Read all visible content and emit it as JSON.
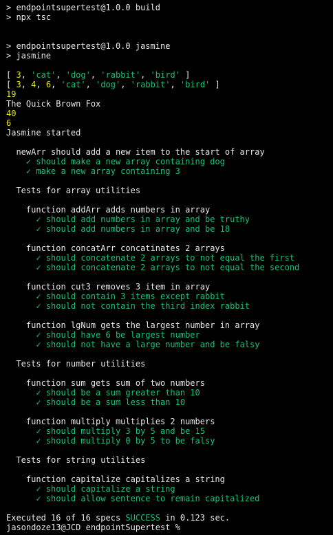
{
  "colors": {
    "background": "#000000",
    "foreground": "#e8e8e8",
    "number": "#e5e510",
    "success": "#1fbf7a"
  },
  "lines": [
    [
      {
        "t": "> endpointsupertest@1.0.0 build",
        "c": "w"
      }
    ],
    [
      {
        "t": "> npx tsc",
        "c": "w"
      }
    ],
    [],
    [],
    [
      {
        "t": "> endpointsupertest@1.0.0 jasmine",
        "c": "w"
      }
    ],
    [
      {
        "t": "> jasmine",
        "c": "w"
      }
    ],
    [],
    [
      {
        "t": "[ ",
        "c": "w"
      },
      {
        "t": "3",
        "c": "y"
      },
      {
        "t": ", ",
        "c": "w"
      },
      {
        "t": "'cat'",
        "c": "g"
      },
      {
        "t": ", ",
        "c": "w"
      },
      {
        "t": "'dog'",
        "c": "g"
      },
      {
        "t": ", ",
        "c": "w"
      },
      {
        "t": "'rabbit'",
        "c": "g"
      },
      {
        "t": ", ",
        "c": "w"
      },
      {
        "t": "'bird'",
        "c": "g"
      },
      {
        "t": " ]",
        "c": "w"
      }
    ],
    [
      {
        "t": "[ ",
        "c": "w"
      },
      {
        "t": "3",
        "c": "y"
      },
      {
        "t": ", ",
        "c": "w"
      },
      {
        "t": "4",
        "c": "y"
      },
      {
        "t": ", ",
        "c": "w"
      },
      {
        "t": "6",
        "c": "y"
      },
      {
        "t": ", ",
        "c": "w"
      },
      {
        "t": "'cat'",
        "c": "g"
      },
      {
        "t": ", ",
        "c": "w"
      },
      {
        "t": "'dog'",
        "c": "g"
      },
      {
        "t": ", ",
        "c": "w"
      },
      {
        "t": "'rabbit'",
        "c": "g"
      },
      {
        "t": ", ",
        "c": "w"
      },
      {
        "t": "'bird'",
        "c": "g"
      },
      {
        "t": " ]",
        "c": "w"
      }
    ],
    [
      {
        "t": "19",
        "c": "y"
      }
    ],
    [
      {
        "t": "The Quick Brown Fox",
        "c": "w"
      }
    ],
    [
      {
        "t": "40",
        "c": "y"
      }
    ],
    [
      {
        "t": "6",
        "c": "y"
      }
    ],
    [
      {
        "t": "Jasmine started",
        "c": "w"
      }
    ],
    [],
    [
      {
        "t": "  newArr should add a new item to the start of array",
        "c": "w"
      }
    ],
    [
      {
        "t": "    ✓ should make a new array containing dog",
        "c": "g"
      }
    ],
    [
      {
        "t": "    ✓ make a new array containing 3",
        "c": "g"
      }
    ],
    [],
    [
      {
        "t": "  Tests for array utilities",
        "c": "w"
      }
    ],
    [],
    [
      {
        "t": "    function addArr adds numbers in array",
        "c": "w"
      }
    ],
    [
      {
        "t": "      ✓ should add numbers in array and be truthy",
        "c": "g"
      }
    ],
    [
      {
        "t": "      ✓ should add numbers in array and be 18",
        "c": "g"
      }
    ],
    [],
    [
      {
        "t": "    function concatArr concatinates 2 arrays",
        "c": "w"
      }
    ],
    [
      {
        "t": "      ✓ should concatenate 2 arrays to not equal the first",
        "c": "g"
      }
    ],
    [
      {
        "t": "      ✓ should concatenate 2 arrays to not equal the second",
        "c": "g"
      }
    ],
    [],
    [
      {
        "t": "    function cut3 removes 3 item in array",
        "c": "w"
      }
    ],
    [
      {
        "t": "      ✓ should contain 3 items except rabbit",
        "c": "g"
      }
    ],
    [
      {
        "t": "      ✓ should not contain the third index rabbit",
        "c": "g"
      }
    ],
    [],
    [
      {
        "t": "    function lgNum gets the largest number in array",
        "c": "w"
      }
    ],
    [
      {
        "t": "      ✓ should have 6 be largest number",
        "c": "g"
      }
    ],
    [
      {
        "t": "      ✓ should not have a large number and be falsy",
        "c": "g"
      }
    ],
    [],
    [
      {
        "t": "  Tests for number utilities",
        "c": "w"
      }
    ],
    [],
    [
      {
        "t": "    function sum gets sum of two numbers",
        "c": "w"
      }
    ],
    [
      {
        "t": "      ✓ should be a sum greater than 10",
        "c": "g"
      }
    ],
    [
      {
        "t": "      ✓ should be a sum less than 10",
        "c": "g"
      }
    ],
    [],
    [
      {
        "t": "    function multiply multiplies 2 numbers",
        "c": "w"
      }
    ],
    [
      {
        "t": "      ✓ should multiply 3 by 5 and be 15",
        "c": "g"
      }
    ],
    [
      {
        "t": "      ✓ should multiply 0 by 5 to be falsy",
        "c": "g"
      }
    ],
    [],
    [
      {
        "t": "  Tests for string utilities",
        "c": "w"
      }
    ],
    [],
    [
      {
        "t": "    function capitalize capitalizes a string",
        "c": "w"
      }
    ],
    [
      {
        "t": "      ✓ should capitalize a string",
        "c": "g"
      }
    ],
    [
      {
        "t": "      ✓ should allow sentence to remain capitalized",
        "c": "g"
      }
    ],
    [],
    [
      {
        "t": "Executed 16 of 16 specs ",
        "c": "w"
      },
      {
        "t": "SUCCESS",
        "c": "g"
      },
      {
        "t": " in 0.123 sec.",
        "c": "w"
      }
    ],
    [
      {
        "t": "jasondoze13@JCD endpointSupertest % ",
        "c": "w"
      }
    ]
  ]
}
